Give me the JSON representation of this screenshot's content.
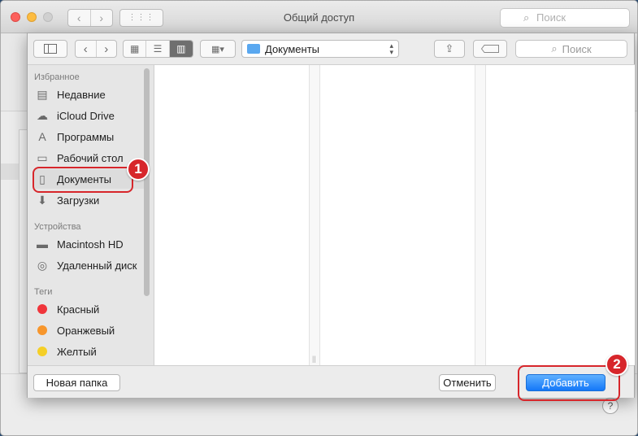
{
  "window": {
    "title": "Общий доступ",
    "search_placeholder": "Поиск",
    "help_label": "?"
  },
  "sheet": {
    "path": "Документы",
    "search_placeholder": "Поиск",
    "new_folder": "Новая папка",
    "cancel": "Отменить",
    "add": "Добавить"
  },
  "sidebar": {
    "favorites_header": "Избранное",
    "favorites": [
      {
        "label": "Недавние",
        "icon": "recents-icon",
        "glyph": "▤"
      },
      {
        "label": "iCloud Drive",
        "icon": "cloud-icon",
        "glyph": "☁"
      },
      {
        "label": "Программы",
        "icon": "applications-icon",
        "glyph": "A"
      },
      {
        "label": "Рабочий стол",
        "icon": "desktop-icon",
        "glyph": "▭"
      },
      {
        "label": "Документы",
        "icon": "documents-icon",
        "glyph": "▯"
      },
      {
        "label": "Загрузки",
        "icon": "downloads-icon",
        "glyph": "⬇"
      }
    ],
    "devices_header": "Устройства",
    "devices": [
      {
        "label": "Macintosh HD",
        "icon": "hard-drive-icon",
        "glyph": "▬"
      },
      {
        "label": "Удаленный диск",
        "icon": "remote-disc-icon",
        "glyph": "◎"
      }
    ],
    "tags_header": "Теги",
    "tags": [
      {
        "label": "Красный",
        "color": "#f0353b"
      },
      {
        "label": "Оранжевый",
        "color": "#f7962c"
      },
      {
        "label": "Желтый",
        "color": "#f5cf27"
      }
    ]
  },
  "annotations": {
    "step1": "1",
    "step2": "2",
    "color": "#d7262b"
  }
}
